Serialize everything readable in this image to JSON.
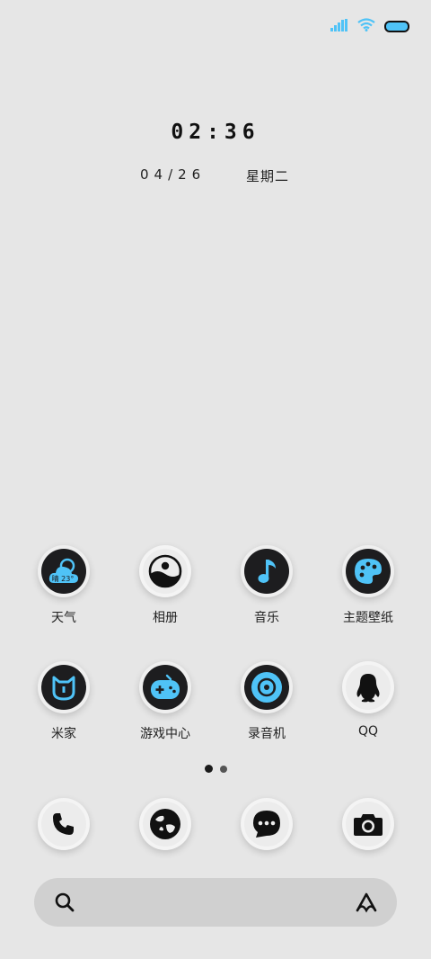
{
  "clock": {
    "time": "02:36",
    "date": "04/26",
    "weekday": "星期二"
  },
  "apps": [
    {
      "name": "weather",
      "label": "天气",
      "badge": "晴 23°"
    },
    {
      "name": "gallery",
      "label": "相册"
    },
    {
      "name": "music",
      "label": "音乐"
    },
    {
      "name": "themes",
      "label": "主题壁纸"
    },
    {
      "name": "mijia",
      "label": "米家"
    },
    {
      "name": "game-center",
      "label": "游戏中心"
    },
    {
      "name": "recorder",
      "label": "录音机"
    },
    {
      "name": "qq",
      "label": "QQ"
    }
  ],
  "pagination": {
    "current": 1,
    "total": 2
  },
  "dock": [
    "phone",
    "browser",
    "messages",
    "camera"
  ],
  "icon_names": {
    "status": [
      "signal-icon",
      "wifi-icon",
      "battery-icon"
    ],
    "search": [
      "search-icon",
      "assistant-icon"
    ]
  },
  "colors": {
    "background": "#e6e6e6",
    "accent": "#4fc3f7",
    "icon_dark": "#1d1d1f",
    "search_bar": "#d0d0d0"
  }
}
